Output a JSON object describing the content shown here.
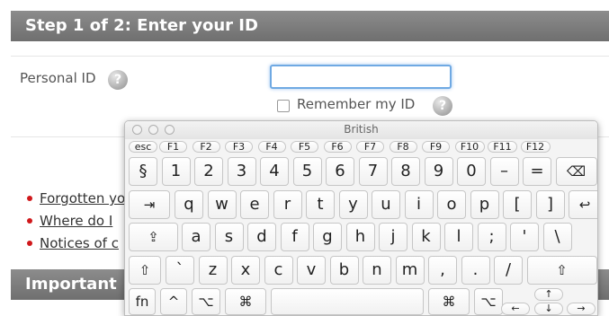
{
  "page": {
    "step_header": "Step 1 of 2: Enter your ID",
    "personal_id_label": "Personal ID",
    "help_glyph": "?",
    "remember_label": "Remember my ID",
    "links": [
      "Forgotten yo",
      "Where do I",
      "Notices of c"
    ],
    "important_header": "Important"
  },
  "keyboard": {
    "window_title": "British",
    "function_row": [
      "esc",
      "F1",
      "F2",
      "F3",
      "F4",
      "F5",
      "F6",
      "F7",
      "F8",
      "F9",
      "F10",
      "F11",
      "F12"
    ],
    "number_row": [
      "§",
      "1",
      "2",
      "3",
      "4",
      "5",
      "6",
      "7",
      "8",
      "9",
      "0",
      "–",
      "=",
      "⌫"
    ],
    "q_row": [
      "⇥",
      "q",
      "w",
      "e",
      "r",
      "t",
      "y",
      "u",
      "i",
      "o",
      "p",
      "[",
      "]",
      "↩"
    ],
    "a_row": [
      "⇪",
      "a",
      "s",
      "d",
      "f",
      "g",
      "h",
      "j",
      "k",
      "l",
      ";",
      "'",
      "\\"
    ],
    "z_row": [
      "⇧",
      "`",
      "z",
      "x",
      "c",
      "v",
      "b",
      "n",
      "m",
      ",",
      ".",
      "/",
      "⇧"
    ],
    "bottom_row": [
      "fn",
      "^",
      "⌥",
      "⌘",
      "",
      "⌘",
      "⌥"
    ],
    "arrows": {
      "up": "↑",
      "left": "←",
      "down": "↓",
      "right": "→"
    }
  },
  "colors": {
    "header_bg": "#7d7d7d",
    "link_bullet": "#d0181b",
    "input_focus": "#6fa9e3"
  }
}
